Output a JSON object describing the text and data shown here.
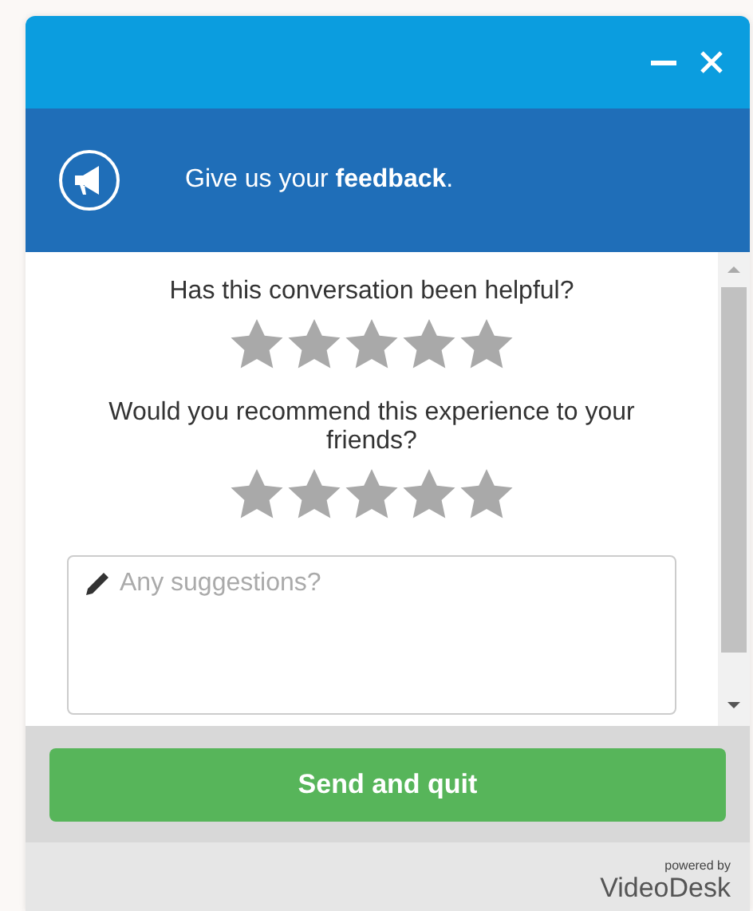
{
  "header": {
    "title": "Give us your **feedback**."
  },
  "questions": [
    {
      "text": "Has this conversation been helpful?",
      "stars": 0
    },
    {
      "text": "Would you recommend this experience to your friends?",
      "stars": 0
    }
  ],
  "suggestions": {
    "placeholder": "Any suggestions?"
  },
  "submit": "Send and quit",
  "branding": {
    "caption": "powered by",
    "name": "VideoDesk"
  }
}
